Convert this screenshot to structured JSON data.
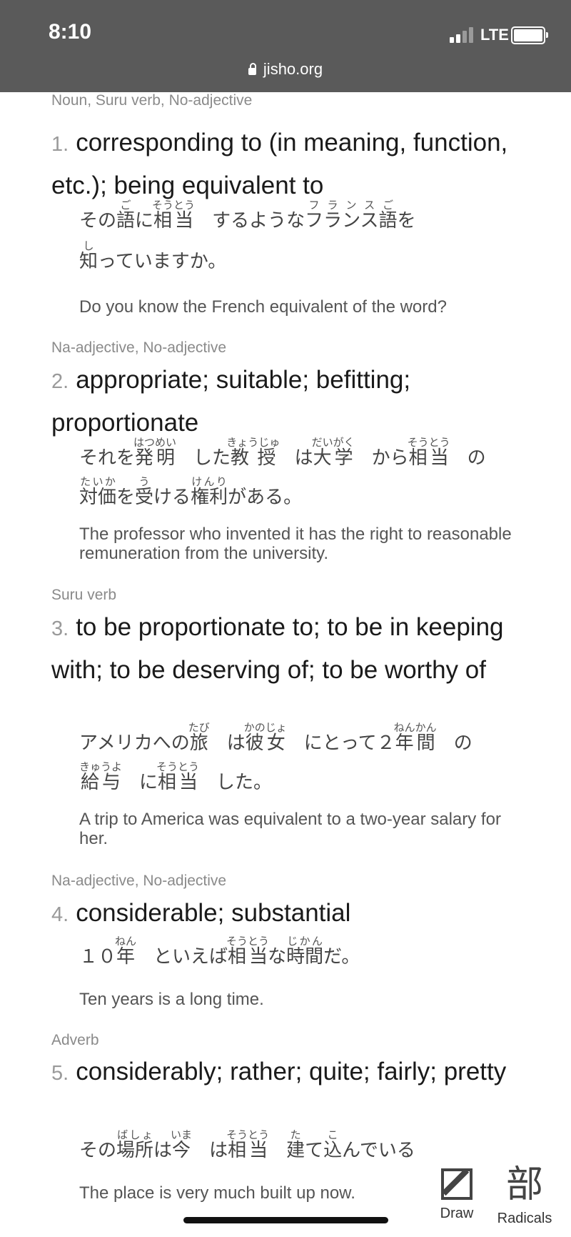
{
  "status": {
    "time": "8:10",
    "network": "LTE"
  },
  "browser": {
    "url": "jisho.org"
  },
  "senses": [
    {
      "pos": "Noun, Suru verb, No-adjective",
      "number": "1.",
      "meaning": "corresponding to (in meaning, function, etc.); being equivalent to",
      "example_en": "Do you know the French equivalent of the word?"
    },
    {
      "pos": "Na-adjective, No-adjective",
      "number": "2.",
      "meaning": "appropriate; suitable; befitting; proportionate",
      "example_en": "The professor who invented it has the right to reasonable remuneration from the university."
    },
    {
      "pos": "Suru verb",
      "number": "3.",
      "meaning": "to be proportionate to; to be in keeping with; to be deserving of; to be worthy of",
      "example_en": "A trip to America was equivalent to a two-year salary for her."
    },
    {
      "pos": "Na-adjective, No-adjective",
      "number": "4.",
      "meaning": "considerable; substantial",
      "example_en": "Ten years is a long time."
    },
    {
      "pos": "Adverb",
      "number": "5.",
      "meaning": "considerably; rather; quite; fairly; pretty",
      "example_en": "The place is very much built up now."
    }
  ],
  "tools": {
    "draw_label": "Draw",
    "radicals_label": "Radicals",
    "radicals_glyph": "部"
  }
}
